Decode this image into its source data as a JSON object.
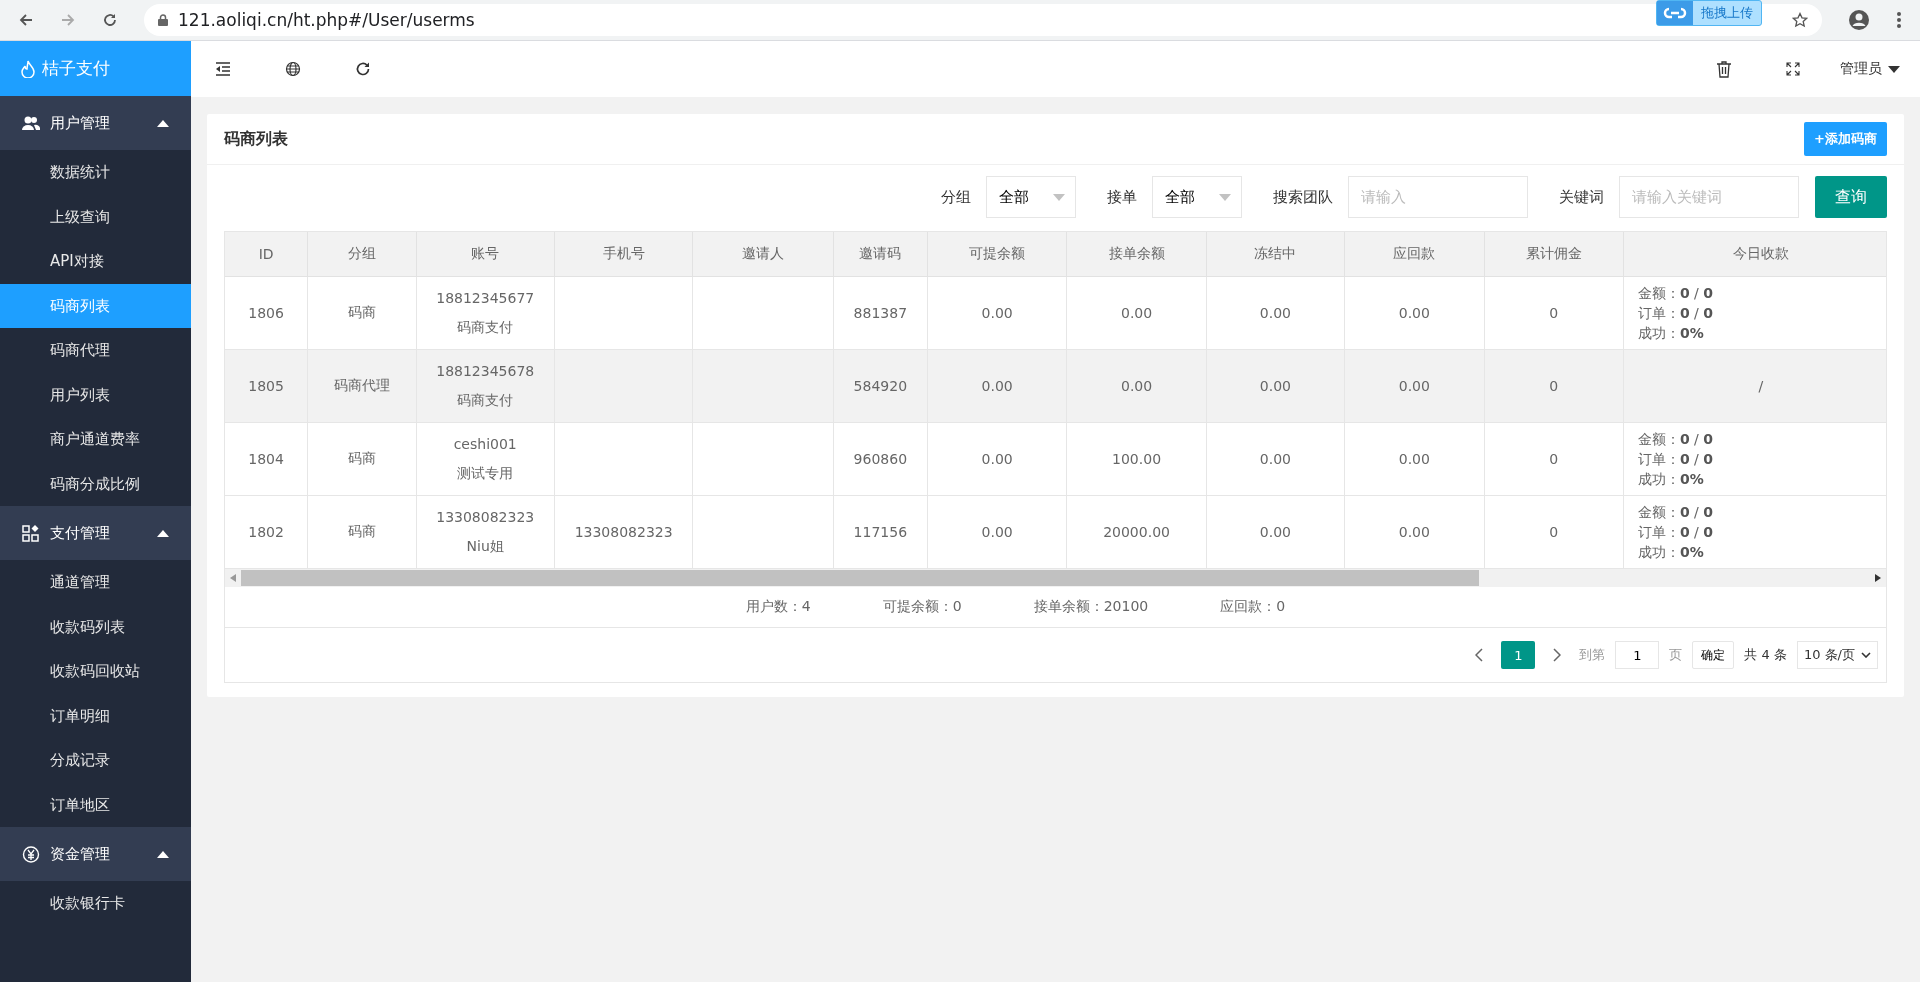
{
  "browser": {
    "url": "121.aoliqi.cn/ht.php#/User/userms",
    "overlay_badge": "拖拽上传"
  },
  "sidebar": {
    "logo": "桔子支付",
    "groups": [
      {
        "label": "用户管理",
        "expanded": true,
        "items": [
          {
            "label": "数据统计",
            "selected": false
          },
          {
            "label": "上级查询",
            "selected": false
          },
          {
            "label": "API对接",
            "selected": false
          },
          {
            "label": "码商列表",
            "selected": true
          },
          {
            "label": "码商代理",
            "selected": false
          },
          {
            "label": "用户列表",
            "selected": false
          },
          {
            "label": "商户通道费率",
            "selected": false
          },
          {
            "label": "码商分成比例",
            "selected": false
          }
        ]
      },
      {
        "label": "支付管理",
        "expanded": true,
        "items": [
          {
            "label": "通道管理",
            "selected": false
          },
          {
            "label": "收款码列表",
            "selected": false
          },
          {
            "label": "收款码回收站",
            "selected": false
          },
          {
            "label": "订单明细",
            "selected": false
          },
          {
            "label": "分成记录",
            "selected": false
          },
          {
            "label": "订单地区",
            "selected": false
          }
        ]
      },
      {
        "label": "资金管理",
        "expanded": true,
        "items": [
          {
            "label": "收款银行卡",
            "selected": false
          }
        ]
      }
    ]
  },
  "header": {
    "user": "管理员"
  },
  "card": {
    "title": "码商列表",
    "add_button": "+添加码商"
  },
  "filters": [
    {
      "kind": "select",
      "label": "分组",
      "value": "全部"
    },
    {
      "kind": "select",
      "label": "接单",
      "value": "全部"
    },
    {
      "kind": "input",
      "label": "搜索团队",
      "placeholder": "请输入"
    },
    {
      "kind": "input",
      "label": "关键词",
      "placeholder": "请输入关键词"
    }
  ],
  "query_button": "查询",
  "table": {
    "columns": [
      "ID",
      "分组",
      "账号",
      "手机号",
      "邀请人",
      "邀请码",
      "可提余额",
      "接单余额",
      "冻结中",
      "应回款",
      "累计佣金",
      "今日收款"
    ],
    "rows": [
      {
        "selected": false,
        "id": "1806",
        "group": "码商",
        "account": [
          "18812345677",
          "码商支付"
        ],
        "phone": "",
        "inviter": "",
        "code": "881387",
        "withdrawable": "0.00",
        "order_balance": "0.00",
        "frozen": "0.00",
        "receivable": "0.00",
        "commission": "0",
        "today": {
          "kind": "stats",
          "lines": [
            "金额：**0** / **0**",
            "订单：**0** / **0**",
            "成功：**0%**"
          ]
        }
      },
      {
        "selected": true,
        "id": "1805",
        "group": "码商代理",
        "account": [
          "18812345678",
          "码商支付"
        ],
        "phone": "",
        "inviter": "",
        "code": "584920",
        "withdrawable": "0.00",
        "order_balance": "0.00",
        "frozen": "0.00",
        "receivable": "0.00",
        "commission": "0",
        "today": {
          "kind": "text",
          "text": "/"
        }
      },
      {
        "selected": false,
        "id": "1804",
        "group": "码商",
        "account": [
          "ceshi001",
          "测试专用"
        ],
        "phone": "",
        "inviter": "",
        "code": "960860",
        "withdrawable": "0.00",
        "order_balance": "100.00",
        "frozen": "0.00",
        "receivable": "0.00",
        "commission": "0",
        "today": {
          "kind": "stats",
          "lines": [
            "金额：**0** / **0**",
            "订单：**0** / **0**",
            "成功：**0%**"
          ]
        }
      },
      {
        "selected": false,
        "id": "1802",
        "group": "码商",
        "account": [
          "13308082323",
          "Niu姐"
        ],
        "phone": "13308082323",
        "inviter": "",
        "code": "117156",
        "withdrawable": "0.00",
        "order_balance": "20000.00",
        "frozen": "0.00",
        "receivable": "0.00",
        "commission": "0",
        "today": {
          "kind": "stats",
          "lines": [
            "金额：**0** / **0**",
            "订单：**0** / **0**",
            "成功：**0%**"
          ]
        }
      }
    ]
  },
  "summary": [
    "用户数：4",
    "可提余额：0",
    "接单余额：20100",
    "应回款：0"
  ],
  "pagination": {
    "pages": [
      {
        "label": "1",
        "selected": true
      }
    ],
    "goto_label": "到第",
    "goto_value": "1",
    "page_unit": "页",
    "confirm": "确定",
    "total": "共 4 条",
    "page_size": "10 条/页"
  }
}
